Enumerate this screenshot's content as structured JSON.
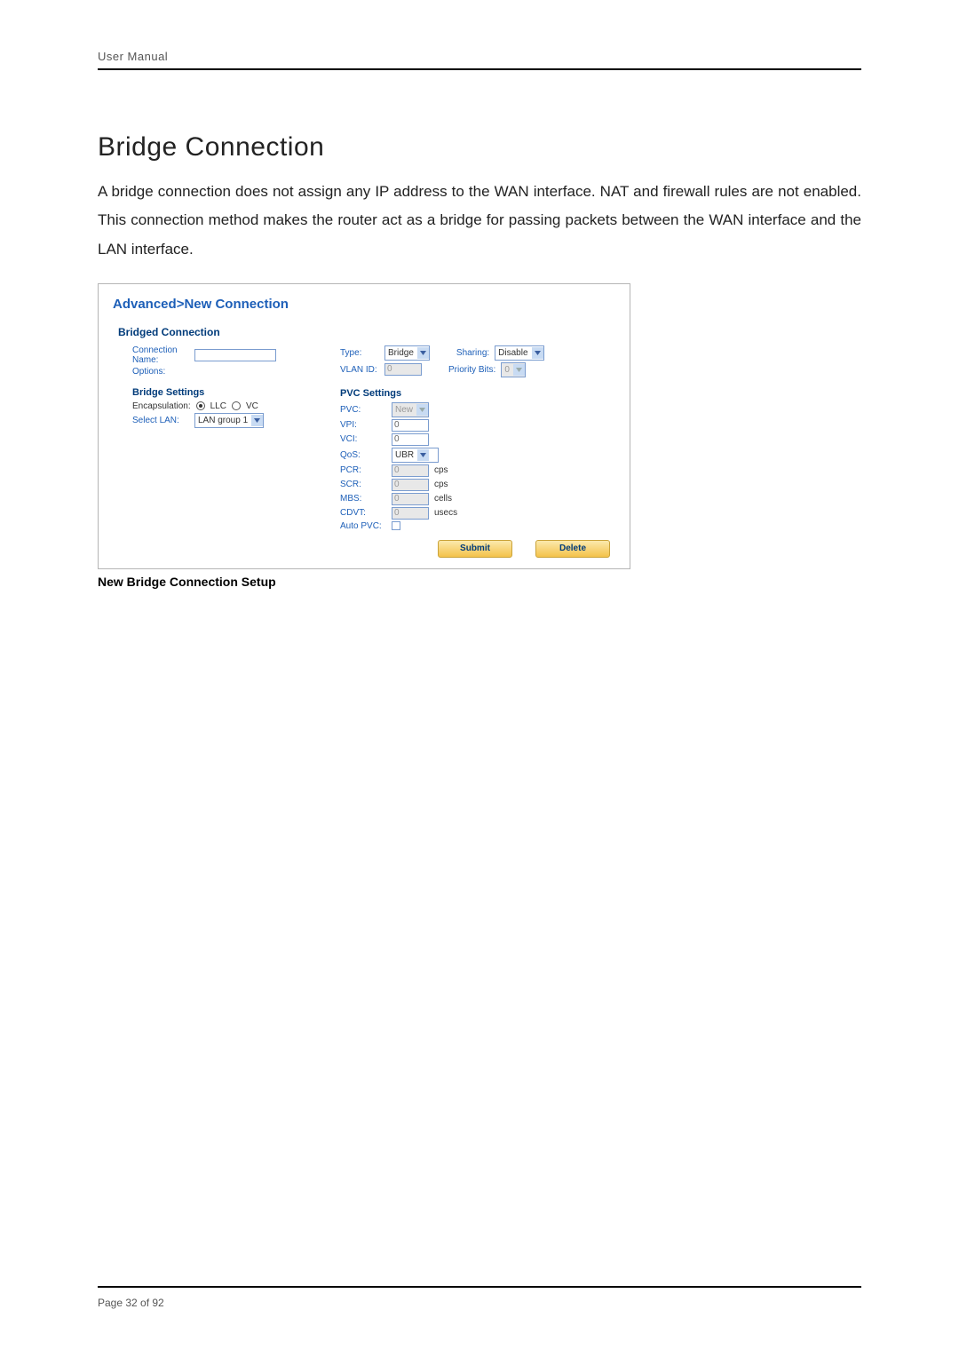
{
  "header": {
    "text": "User Manual"
  },
  "title": "Bridge Connection",
  "paragraph": "A bridge connection does not assign any IP address to the WAN interface. NAT and firewall rules are not enabled. This connection method makes the router act as a bridge for passing packets between the WAN interface and the LAN interface.",
  "screenshot": {
    "breadcrumb": "Advanced>New Connection",
    "section_title": "Bridged Connection",
    "labels": {
      "connection_name": "Connection Name:",
      "options": "Options:",
      "type": "Type:",
      "sharing": "Sharing:",
      "vlan_id": "VLAN ID:",
      "priority_bits": "Priority Bits:"
    },
    "values": {
      "connection_name": "",
      "type": "Bridge",
      "sharing": "Disable",
      "vlan_id": "0",
      "priority_bits": "0"
    },
    "bridge_settings": {
      "title": "Bridge Settings",
      "encapsulation_label": "Encapsulation:",
      "enc_llc": "LLC",
      "enc_vc": "VC",
      "select_lan_label": "Select LAN:",
      "select_lan": "LAN group 1"
    },
    "pvc_settings": {
      "title": "PVC Settings",
      "rows": {
        "pvc": {
          "label": "PVC:",
          "value": "New",
          "is_select": true,
          "disabled": true
        },
        "vpi": {
          "label": "VPI:",
          "value": "0"
        },
        "vci": {
          "label": "VCI:",
          "value": "0"
        },
        "qos": {
          "label": "QoS:",
          "value": "UBR",
          "is_select": true
        },
        "pcr": {
          "label": "PCR:",
          "value": "0",
          "unit": "cps",
          "disabled": true
        },
        "scr": {
          "label": "SCR:",
          "value": "0",
          "unit": "cps",
          "disabled": true
        },
        "mbs": {
          "label": "MBS:",
          "value": "0",
          "unit": "cells",
          "disabled": true
        },
        "cdvt": {
          "label": "CDVT:",
          "value": "0",
          "unit": "usecs",
          "disabled": true
        },
        "autopvc": {
          "label": "Auto PVC:"
        }
      }
    },
    "buttons": {
      "submit": "Submit",
      "delete": "Delete"
    }
  },
  "caption": "New Bridge Connection Setup",
  "footer": {
    "page_text": "Page 32 of 92"
  }
}
